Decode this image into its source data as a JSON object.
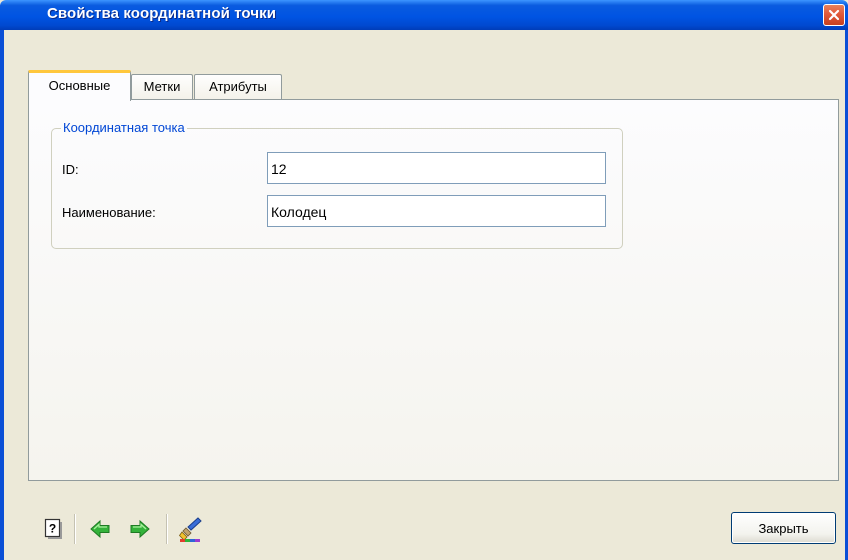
{
  "window": {
    "title": "Свойства координатной точки",
    "close_icon": "close-icon"
  },
  "tabs": [
    {
      "label": "Основные",
      "active": true
    },
    {
      "label": "Метки",
      "active": false
    },
    {
      "label": "Атрибуты",
      "active": false
    }
  ],
  "group": {
    "legend": "Координатная точка",
    "fields": [
      {
        "label": "ID:",
        "value": "12"
      },
      {
        "label": "Наименование:",
        "value": "Колодец"
      }
    ]
  },
  "toolbar": {
    "icons": [
      "help-icon",
      "back-arrow-icon",
      "forward-arrow-icon",
      "brush-icon"
    ]
  },
  "buttons": {
    "close_label": "Закрыть"
  },
  "colors": {
    "titlebar": "#0054e3",
    "active_tab_accent": "#ffc73c",
    "group_legend": "#0046d5",
    "arrow_green": "#34b23a"
  }
}
